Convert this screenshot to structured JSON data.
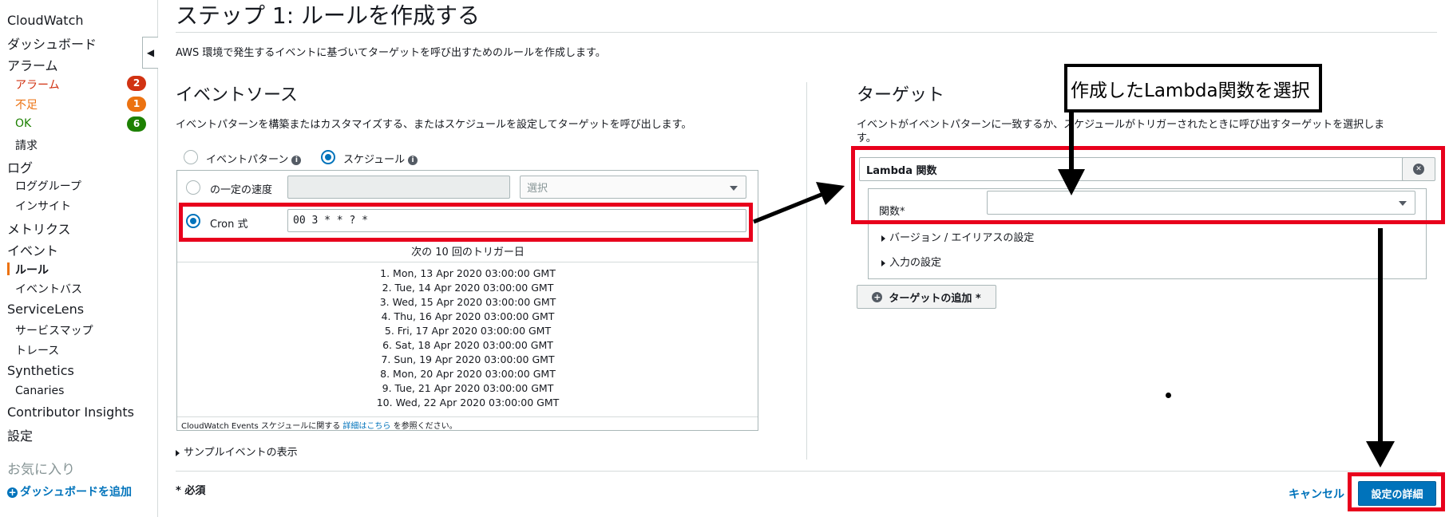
{
  "sidebar": {
    "cloudwatch": "CloudWatch",
    "dashboard": "ダッシュボード",
    "alarms_header": "アラーム",
    "alarm_in_alarm": "アラーム",
    "alarm_in_alarm_count": "2",
    "alarm_insufficient": "不足",
    "alarm_insufficient_count": "1",
    "alarm_ok": "OK",
    "alarm_ok_count": "6",
    "billing": "請求",
    "logs": "ログ",
    "log_groups": "ロググループ",
    "insights": "インサイト",
    "metrics": "メトリクス",
    "events": "イベント",
    "rules": "ルール",
    "event_buses": "イベントバス",
    "servicelens": "ServiceLens",
    "service_map": "サービスマップ",
    "traces": "トレース",
    "synthetics": "Synthetics",
    "canaries": "Canaries",
    "contributor_insights": "Contributor Insights",
    "settings": "設定",
    "favorites": "お気に入り",
    "add_dashboard": "ダッシュボードを追加",
    "collapse_glyph": "◀"
  },
  "page": {
    "title": "ステップ 1: ルールを作成する",
    "description": "AWS 環境で発生するイベントに基づいてターゲットを呼び出すためのルールを作成します。"
  },
  "event_source": {
    "heading": "イベントソース",
    "description": "イベントパターンを構築またはカスタマイズする、またはスケジュールを設定してターゲットを呼び出します。",
    "option_event_pattern": "イベントパターン",
    "option_schedule": "スケジュール",
    "fixed_rate_label": "の一定の速度",
    "fixed_rate_value": "",
    "unit_placeholder": "選択",
    "cron_label": "Cron 式",
    "cron_value": "00 3 * * ? *",
    "next_triggers_header": "次の 10 回のトリガー日",
    "next_triggers": [
      "1. Mon, 13 Apr 2020 03:00:00 GMT",
      "2. Tue, 14 Apr 2020 03:00:00 GMT",
      "3. Wed, 15 Apr 2020 03:00:00 GMT",
      "4. Thu, 16 Apr 2020 03:00:00 GMT",
      "5. Fri, 17 Apr 2020 03:00:00 GMT",
      "6. Sat, 18 Apr 2020 03:00:00 GMT",
      "7. Sun, 19 Apr 2020 03:00:00 GMT",
      "8. Mon, 20 Apr 2020 03:00:00 GMT",
      "9. Tue, 21 Apr 2020 03:00:00 GMT",
      "10. Wed, 22 Apr 2020 03:00:00 GMT"
    ],
    "footnote_prefix": "CloudWatch Events スケジュールに関する",
    "footnote_link": "詳細はこちら",
    "footnote_suffix": "を参照ください。",
    "sample_event": "サンプルイベントの表示"
  },
  "targets": {
    "heading": "ターゲット",
    "description": "イベントがイベントパターンに一致するか、スケジュールがトリガーされたときに呼び出すターゲットを選択しま",
    "description_cont": "す。",
    "target_type": "Lambda 関数",
    "function_label": "関数*",
    "function_value": "",
    "version_alias": "バージョン / エイリアスの設定",
    "input_config": "入力の設定",
    "add_target": "ターゲットの追加 *",
    "remove_glyph": "✕",
    "add_glyph": "+"
  },
  "callout": {
    "text": "作成したLambda関数を選択"
  },
  "footer": {
    "required_note": "* 必須",
    "cancel": "キャンセル",
    "configure_details": "設定の詳細"
  },
  "colors": {
    "annotation_red": "#e8001c",
    "primary_blue": "#0073bb",
    "alarm_red": "#d13212",
    "alarm_orange": "#ec7211",
    "ok_green": "#1d8102"
  }
}
